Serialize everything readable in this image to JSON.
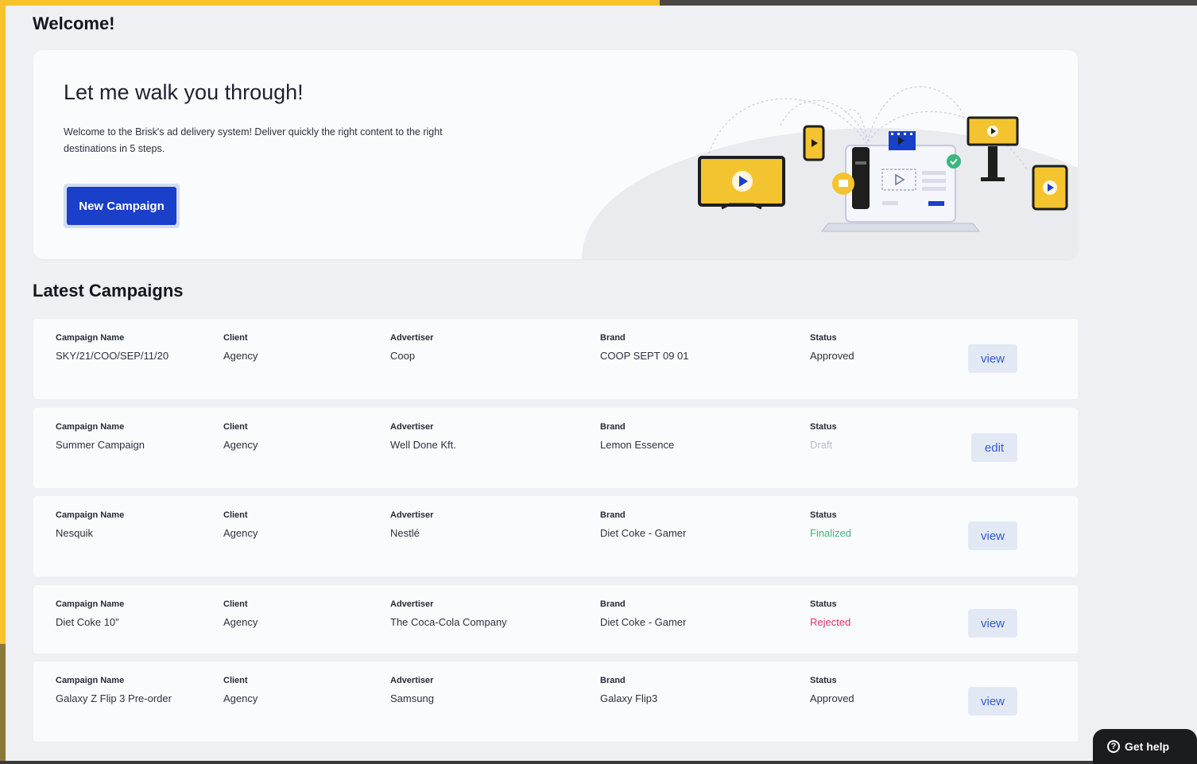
{
  "page": {
    "welcome_title": "Welcome!",
    "section_title": "Latest Campaigns"
  },
  "hero": {
    "heading": "Let me walk you through!",
    "description": "Welcome to the Brisk's ad delivery system! Deliver quickly the right content to the right destinations in 5 steps.",
    "cta_label": "New Campaign"
  },
  "labels": {
    "campaign_name": "Campaign Name",
    "client": "Client",
    "advertiser": "Advertiser",
    "brand": "Brand",
    "status": "Status"
  },
  "campaigns": [
    {
      "name": "SKY/21/COO/SEP/11/20",
      "client": "Agency",
      "advertiser": "Coop",
      "brand": "COOP SEPT 09 01",
      "status": "Approved",
      "action": "view"
    },
    {
      "name": "Summer Campaign",
      "client": "Agency",
      "advertiser": "Well Done Kft.",
      "brand": "Lemon Essence",
      "status": "Draft",
      "action": "edit"
    },
    {
      "name": "Nesquik",
      "client": "Agency",
      "advertiser": "Nestlé",
      "brand": "Diet Coke - Gamer",
      "status": "Finalized",
      "action": "view"
    },
    {
      "name": "Diet Coke 10\"",
      "client": "Agency",
      "advertiser": "The Coca-Cola Company",
      "brand": "Diet Coke - Gamer",
      "status": "Rejected",
      "action": "view"
    },
    {
      "name": "Galaxy Z Flip 3 Pre-order",
      "client": "Agency",
      "advertiser": "Samsung",
      "brand": "Galaxy Flip3",
      "status": "Approved",
      "action": "view"
    }
  ],
  "help": {
    "label": "Get help",
    "icon_glyph": "?"
  },
  "colors": {
    "accent": "#1a3fc8",
    "frame": "#f7c22a",
    "status_approved": "#2c3140",
    "status_draft": "#b8bcc6",
    "status_finalized": "#3bb77e",
    "status_rejected": "#e0306e"
  }
}
